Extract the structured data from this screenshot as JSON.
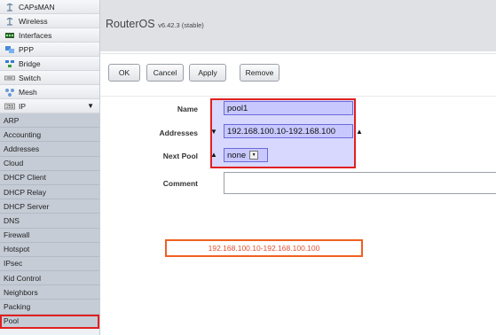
{
  "sidebar": {
    "top_items": [
      {
        "label": "CAPsMAN",
        "icon": "antenna-icon"
      },
      {
        "label": "Wireless",
        "icon": "antenna-icon"
      },
      {
        "label": "Interfaces",
        "icon": "interfaces-icon"
      },
      {
        "label": "PPP",
        "icon": "ppp-icon"
      },
      {
        "label": "Bridge",
        "icon": "bridge-icon"
      },
      {
        "label": "Switch",
        "icon": "switch-icon"
      },
      {
        "label": "Mesh",
        "icon": "mesh-icon"
      },
      {
        "label": "IP",
        "icon": "ip-icon"
      }
    ],
    "ip_sub_items": [
      "ARP",
      "Accounting",
      "Addresses",
      "Cloud",
      "DHCP Client",
      "DHCP Relay",
      "DHCP Server",
      "DNS",
      "Firewall",
      "Hotspot",
      "IPsec",
      "Kid Control",
      "Neighbors",
      "Packing",
      "Pool"
    ],
    "active": "Pool"
  },
  "header": {
    "brand": "RouterOS",
    "version": "v6.42.3 (stable)"
  },
  "toolbar": {
    "ok_label": "OK",
    "cancel_label": "Cancel",
    "apply_label": "Apply",
    "remove_label": "Remove"
  },
  "form": {
    "name_label": "Name",
    "name_value": "pool1",
    "addresses_label": "Addresses",
    "addresses_value": "192.168.100.10-192.168.100",
    "next_pool_label": "Next Pool",
    "next_pool_value": "none",
    "comment_label": "Comment",
    "comment_value": ""
  },
  "annotation": {
    "range_text": "192.168.100.10-192.168.100.100"
  },
  "colors": {
    "highlight_border": "#e02020",
    "field_bg": "#c8c8ff",
    "note_border": "#f06020"
  }
}
